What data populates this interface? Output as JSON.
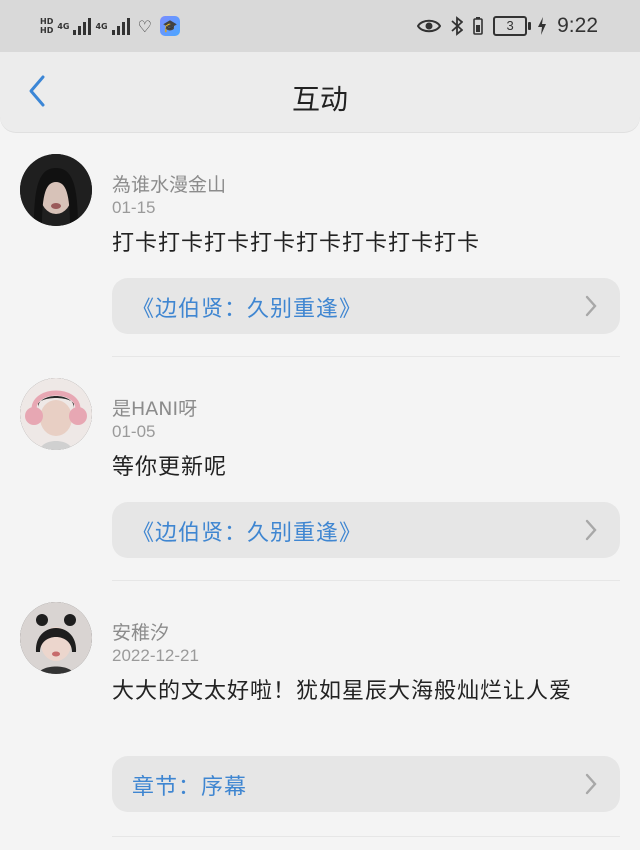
{
  "status_bar": {
    "net1": "4G",
    "net2": "4G",
    "hd1": "HD",
    "hd2": "HD",
    "battery": "3",
    "time": "9:22",
    "icons": [
      "eye-icon",
      "bluetooth-icon",
      "battery-icon",
      "charging-icon"
    ]
  },
  "header": {
    "title": "互动",
    "back_icon": "chevron-left-icon"
  },
  "comments": [
    {
      "name": "為谁水漫金山",
      "date": "01-15",
      "text": "打卡打卡打卡打卡打卡打卡打卡打卡",
      "chapter": "《边伯贤：久别重逢》"
    },
    {
      "name": "是HANI呀",
      "date": "01-05",
      "text": "等你更新呢",
      "chapter": "《边伯贤：久别重逢》"
    },
    {
      "name": "安稚汐",
      "date": "2022-12-21",
      "text": "大大的文太好啦！犹如星辰大海般灿烂让人爱",
      "chapter": "章节：序幕"
    }
  ],
  "colors": {
    "accent": "#3f86d1",
    "background": "#f4f4f4"
  }
}
